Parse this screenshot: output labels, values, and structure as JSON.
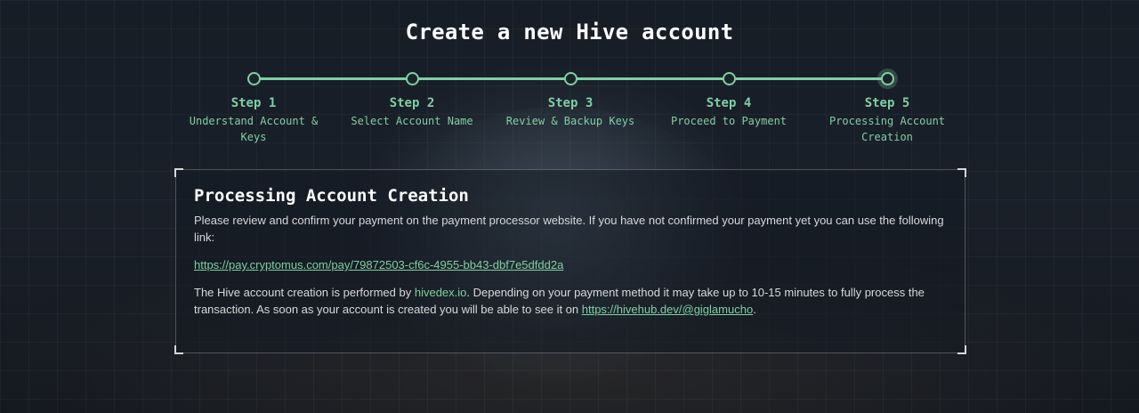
{
  "page": {
    "title": "Create a new Hive account"
  },
  "stepper": {
    "steps": [
      {
        "title": "Step 1",
        "desc": "Understand Account & Keys"
      },
      {
        "title": "Step 2",
        "desc": "Select Account Name"
      },
      {
        "title": "Step 3",
        "desc": "Review & Backup Keys"
      },
      {
        "title": "Step 4",
        "desc": "Proceed to Payment"
      },
      {
        "title": "Step 5",
        "desc": "Processing Account Creation"
      }
    ],
    "current_step": 5
  },
  "panel": {
    "title": "Processing Account Creation",
    "intro": "Please review and confirm your payment on the payment processor website. If you have not confirmed your payment yet you can use the following link:",
    "payment_link": "https://pay.cryptomus.com/pay/79872503-cf6c-4955-bb43-dbf7e5dfdd2a",
    "note_prefix": "The Hive account creation is performed by ",
    "provider": "hivedex.io",
    "note_middle": ". Depending on your payment method it may take up to 10-15 minutes to fully process the transaction. As soon as your account is created you will be able to see it on ",
    "account_link": "https://hivehub.dev/@giglamucho",
    "note_suffix": "."
  },
  "colors": {
    "accent": "#7fcfa3",
    "background": "#141a22",
    "text": "#d8d8d8"
  }
}
